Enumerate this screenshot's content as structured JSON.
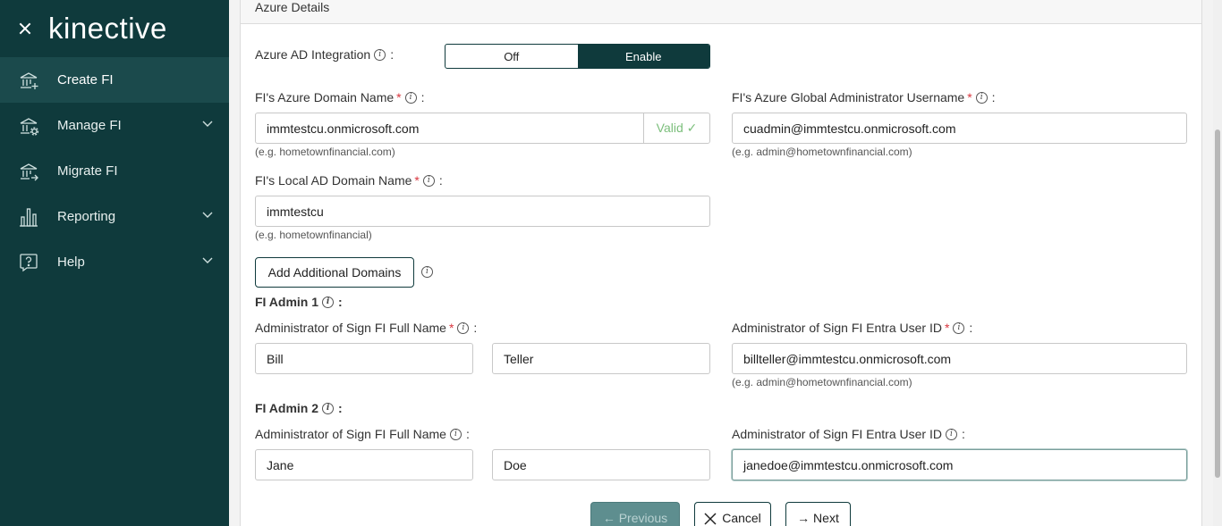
{
  "sidebar": {
    "logo": "kinective",
    "items": [
      {
        "label": "Create FI",
        "icon": "bank-plus-icon"
      },
      {
        "label": "Manage FI",
        "icon": "bank-gear-icon"
      },
      {
        "label": "Migrate FI",
        "icon": "bank-arrow-icon"
      },
      {
        "label": "Reporting",
        "icon": "bar-chart-icon"
      },
      {
        "label": "Help",
        "icon": "help-icon"
      }
    ]
  },
  "section": {
    "title": "Azure Details"
  },
  "azure_ad": {
    "label": "Azure AD Integration",
    "off_label": "Off",
    "enable_label": "Enable",
    "selected": "Enable"
  },
  "domain_name": {
    "label": "FI's Azure Domain Name",
    "value": "immtestcu.onmicrosoft.com",
    "status": "Valid ✓",
    "hint": "(e.g. hometownfinancial.com)"
  },
  "global_admin": {
    "label": "FI's Azure Global Administrator Username",
    "value": "cuadmin@immtestcu.onmicrosoft.com",
    "hint": "(e.g. admin@hometownfinancial.com)"
  },
  "local_domain": {
    "label": "FI's Local AD Domain Name",
    "value": "immtestcu",
    "hint": "(e.g. hometownfinancial)"
  },
  "add_domains_label": "Add Additional Domains",
  "admin1": {
    "heading": "FI Admin 1",
    "name_label": "Administrator of Sign FI Full Name",
    "first": "Bill",
    "last": "Teller",
    "entra_label": "Administrator of Sign FI Entra User ID",
    "entra_value": "billteller@immtestcu.onmicrosoft.com",
    "hint": "(e.g. admin@hometownfinancial.com)"
  },
  "admin2": {
    "heading": "FI Admin 2",
    "name_label": "Administrator of Sign FI Full Name",
    "first": "Jane",
    "last": "Doe",
    "entra_label": "Administrator of Sign FI Entra User ID",
    "entra_value": "janedoe@immtestcu.onmicrosoft.com"
  },
  "footer": {
    "previous": "← Previous",
    "cancel": "Cancel",
    "next": "→ Next"
  },
  "colors": {
    "brand": "#0f3a3c",
    "required": "#d9363e",
    "valid": "#7cbf7c"
  }
}
